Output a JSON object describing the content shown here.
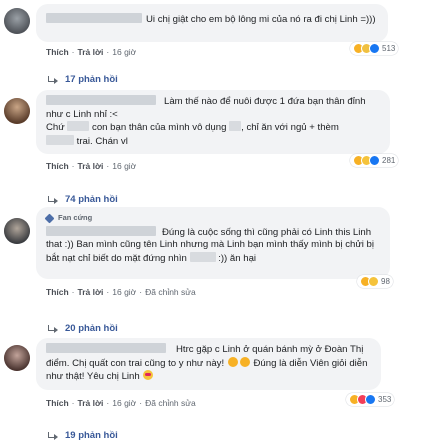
{
  "comments": [
    {
      "text": "Ui chị giật cho em bộ lông mi của nó ra đi chị Linh =)))",
      "actions": [
        "Thích",
        "Trả lời",
        "16 giờ"
      ],
      "reaction_count": "513",
      "replies": "17 phản hồi"
    },
    {
      "text_1": "Làm thế nào để nuôi được 1 đứa bạn thân đỉnh như c Linh nhỉ :<",
      "text_2": "Chứ",
      "text_3": "con bạn thân của mình vô dụng",
      "text_4": ", chỉ ăn với ngủ + thèm",
      "text_5": "trai. Chán vl",
      "actions": [
        "Thích",
        "Trả lời",
        "16 giờ"
      ],
      "reaction_count": "281",
      "replies": "74 phản hồi"
    },
    {
      "badge": "Fan cứng",
      "text_1": "Đúng là cuộc sống thì cũng phải có Linh this Linh that :)) Ban mình cũng tên Linh nhưng mà Linh bạn mình thấy mình bị chửi bị bắt nạt chỉ biết do mặt đứng nhìn",
      "text_2": ":)) ăn hại",
      "actions": [
        "Thích",
        "Trả lời",
        "16 giờ",
        "Đã chỉnh sửa"
      ],
      "reaction_count": "98",
      "replies": "20 phản hồi"
    },
    {
      "text_1": "Htrc gặp c Linh ở quán bánh mỳ ở Đoàn Thị điểm. Chị quất con trai cũng to y như này!",
      "text_2": "Đúng là diễn Viên giỏi diễn như thật! Yêu chị Linh",
      "actions": [
        "Thích",
        "Trả lời",
        "16 giờ",
        "Đã chỉnh sửa"
      ],
      "reaction_count": "353",
      "replies": "19 phản hồi"
    }
  ]
}
